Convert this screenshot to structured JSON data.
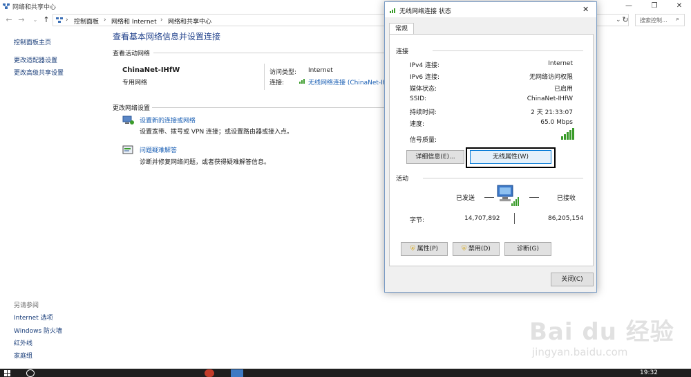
{
  "window": {
    "title": "网络和共享中心",
    "controls": {
      "minimize": "—",
      "maximize": "❐",
      "close": "✕"
    }
  },
  "address": {
    "crumbs": [
      "控制面板",
      "网络和 Internet",
      "网络和共享中心"
    ],
    "search_placeholder": "搜索控制...",
    "refresh": "↻"
  },
  "left_pane": {
    "items": [
      "控制面板主页",
      "更改适配器设置",
      "更改高级共享设置"
    ],
    "see_also_title": "另请参阅",
    "see_also": [
      "Internet 选项",
      "Windows 防火墙",
      "红外线",
      "家庭组"
    ]
  },
  "main": {
    "heading": "查看基本网络信息并设置连接",
    "active_title": "查看活动网络",
    "network_name": "ChinaNet-IHfW",
    "network_type": "专用网络",
    "access_label": "访问类型:",
    "access_value": "Internet",
    "conn_label": "连接:",
    "conn_value": "无线网络连接 (ChinaNet-IH...",
    "change_title": "更改网络设置",
    "setup_link": "设置新的连接或网络",
    "setup_desc": "设置宽带、拨号或 VPN 连接；或设置路由器或接入点。",
    "troubleshoot_link": "问题疑难解答",
    "troubleshoot_desc": "诊断并修复网络问题，或者获得疑难解答信息。"
  },
  "dialog": {
    "title": "无线网络连接 状态",
    "close": "✕",
    "tab": "常规",
    "section_connection": "连接",
    "rows": [
      {
        "label": "IPv4 连接:",
        "value": "Internet"
      },
      {
        "label": "IPv6 连接:",
        "value": "无网络访问权限"
      },
      {
        "label": "媒体状态:",
        "value": "已启用"
      },
      {
        "label": "SSID:",
        "value": "ChinaNet-IHfW"
      },
      {
        "label": "持续时间:",
        "value": "2 天 21:33:07"
      },
      {
        "label": "速度:",
        "value": "65.0 Mbps"
      }
    ],
    "signal_label": "信号质量:",
    "btn_details": "详细信息(E)...",
    "btn_wireless": "无线属性(W)",
    "section_activity": "活动",
    "sent_label": "已发送",
    "recv_label": "已接收",
    "bytes_label": "字节:",
    "bytes_sent": "14,707,892",
    "bytes_recv": "86,205,154",
    "btn_properties": "属性(P)",
    "btn_disable": "禁用(D)",
    "btn_diagnose": "诊断(G)",
    "btn_close": "关闭(C)"
  },
  "taskbar": {
    "time": "19:32"
  },
  "watermark": {
    "brand": "Bai du 经验",
    "url": "jingyan.baidu.com"
  },
  "colors": {
    "link": "#1a5fb4",
    "highlight_border": "#000000",
    "signal": "#3a9b2a"
  }
}
